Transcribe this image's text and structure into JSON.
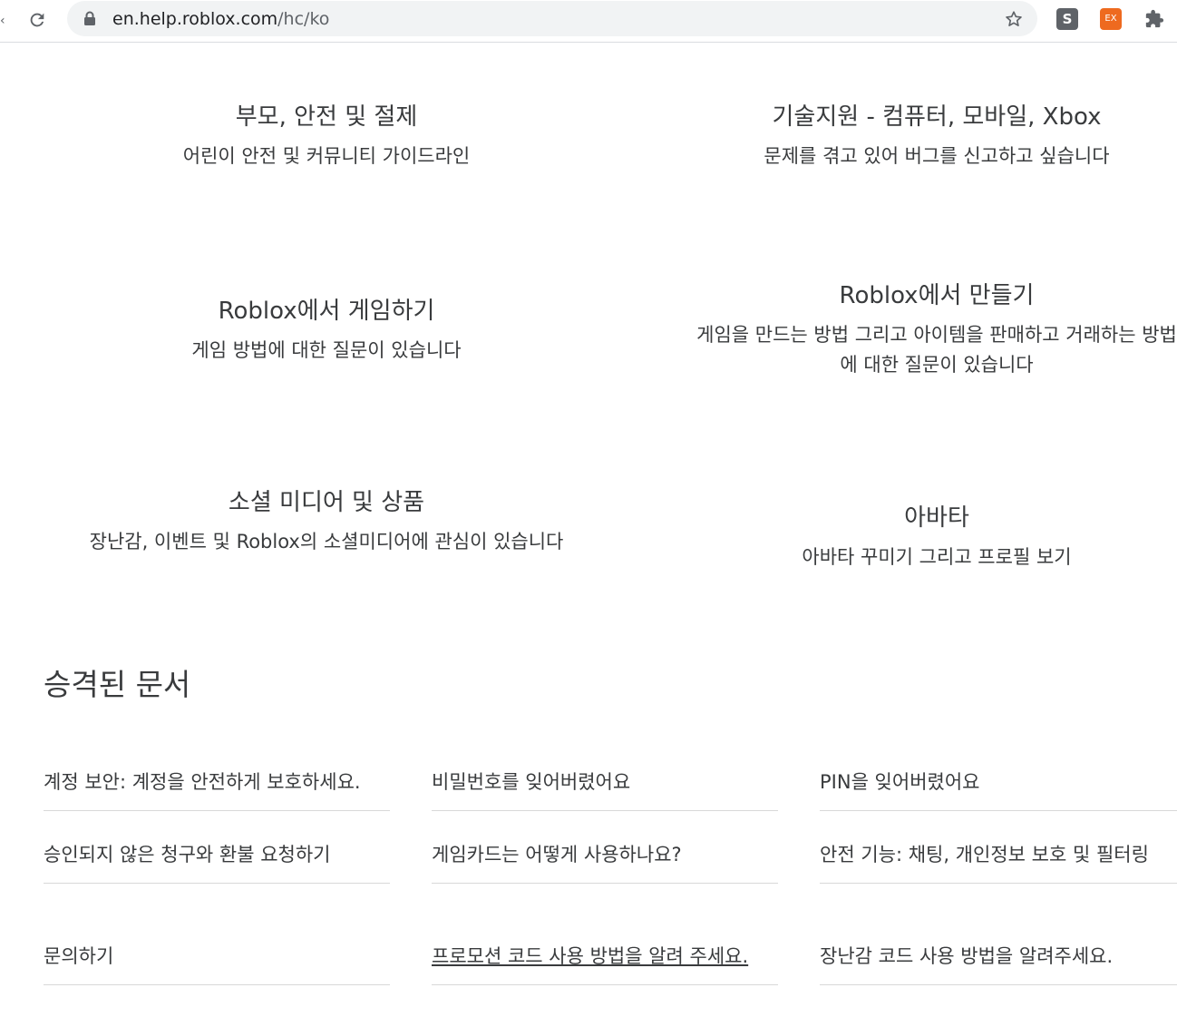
{
  "browser": {
    "url_host": "en.help.roblox.com",
    "url_path": "/hc/ko",
    "extension_s_label": "S",
    "extension_ex_label": "EX",
    "accent_ex_color": "#ee6a1f"
  },
  "categories": [
    {
      "title": "부모, 안전 및 절제",
      "description": "어린이 안전 및 커뮤니티 가이드라인"
    },
    {
      "title": "기술지원 - 컴퓨터, 모바일, Xbox",
      "description": "문제를 겪고 있어 버그를 신고하고 싶습니다"
    },
    {
      "title": "Roblox에서 게임하기",
      "description": "게임 방법에 대한 질문이 있습니다"
    },
    {
      "title": "Roblox에서 만들기",
      "description": "게임을 만드는 방법 그리고 아이템을 판매하고 거래하는 방법에 대한 질문이 있습니다"
    },
    {
      "title": "소셜 미디어 및 상품",
      "description": "장난감, 이벤트 및 Roblox의 소셜미디어에 관심이 있습니다"
    },
    {
      "title": "아바타",
      "description": "아바타 꾸미기 그리고 프로필 보기"
    }
  ],
  "promoted": {
    "title": "승격된 문서",
    "articles": [
      "계정 보안: 계정을 안전하게 보호하세요.",
      "비밀번호를 잊어버렸어요",
      "PIN을 잊어버렸어요",
      "승인되지 않은 청구와 환불 요청하기",
      "게임카드는 어떻게 사용하나요?",
      "안전 기능: 채팅, 개인정보 보호 및 필터링",
      "문의하기",
      "프로모션 코드 사용 방법을 알려 주세요.",
      "장난감 코드 사용 방법을 알려주세요."
    ]
  }
}
